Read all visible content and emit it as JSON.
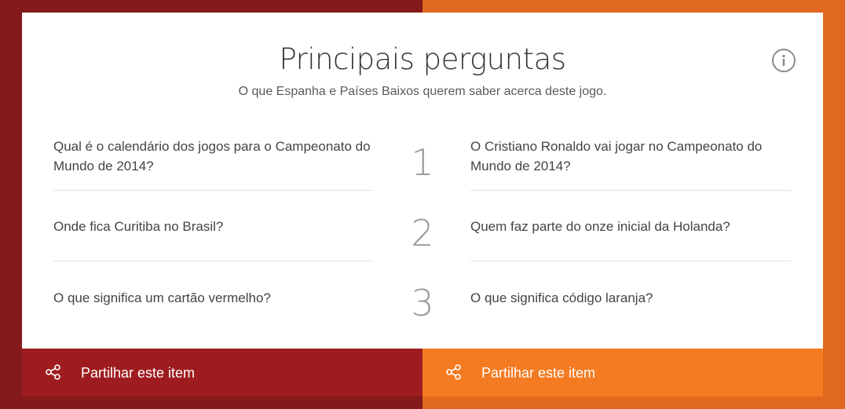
{
  "colors": {
    "left_team": "#841a1a",
    "right_team": "#e0691f",
    "left_share": "#9e1c20",
    "right_share": "#f47b22"
  },
  "header": {
    "title": "Principais perguntas",
    "subtitle": "O que Espanha e Países Baixos querem saber acerca deste jogo.",
    "info_icon": "info-icon"
  },
  "ranks": [
    "1",
    "2",
    "3"
  ],
  "left_questions": [
    "Qual é o calendário dos jogos para o Campeonato do Mundo de 2014?",
    "Onde fica Curitiba no Brasil?",
    "O que significa um cartão vermelho?"
  ],
  "right_questions": [
    "O Cristiano Ronaldo vai jogar no Campeonato do Mundo de 2014?",
    "Quem faz parte do onze inicial da Holanda?",
    "O que significa código laranja?"
  ],
  "share": {
    "left_label": "Partilhar este item",
    "right_label": "Partilhar este item",
    "icon": "share-icon"
  }
}
